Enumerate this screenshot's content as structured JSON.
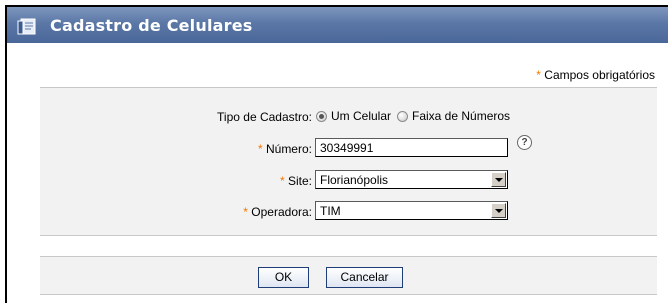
{
  "window": {
    "title": "Cadastro de Celulares",
    "icon": "phonebook-icon"
  },
  "required_note": {
    "star": "*",
    "text": " Campos obrigatórios"
  },
  "form": {
    "tipo_cadastro": {
      "label": "Tipo de Cadastro:",
      "options": [
        {
          "label": "Um Celular",
          "checked": true
        },
        {
          "label": "Faixa de Números",
          "checked": false
        }
      ]
    },
    "numero": {
      "star": "*",
      "label": " Número:",
      "value": "30349991",
      "help_icon": "help-icon",
      "help_glyph": "?"
    },
    "site": {
      "star": "*",
      "label": " Site:",
      "value": "Florianópolis"
    },
    "operadora": {
      "star": "*",
      "label": " Operadora:",
      "value": "TIM"
    }
  },
  "buttons": {
    "ok": "OK",
    "cancel": "Cancelar"
  },
  "colors": {
    "titlebar": "#5b77a6",
    "required_star": "#f07800",
    "panel_bg": "#f2f2f2",
    "button_border": "#1f3e78"
  }
}
